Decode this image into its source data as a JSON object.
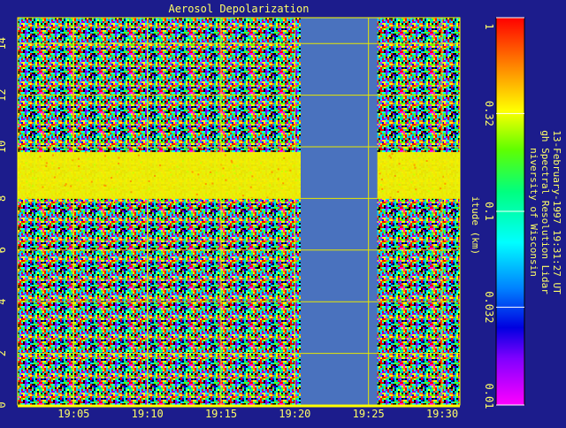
{
  "chart_data": {
    "type": "heatmap",
    "title": "Aerosol Depolarization",
    "ylabel": "itude (km)",
    "x_ticks": [
      "19:05",
      "19:10",
      "19:15",
      "19:20",
      "19:25",
      "19:30"
    ],
    "x_tick_minutes": [
      5,
      10,
      15,
      20,
      25,
      30
    ],
    "xlim_minutes": [
      1.2,
      31.2
    ],
    "y_ticks": [
      "0",
      "2",
      "4",
      "6",
      "8",
      "10",
      "12",
      "14"
    ],
    "y_tick_values": [
      0,
      2,
      4,
      6,
      8,
      10,
      12,
      14
    ],
    "ylim": [
      0,
      15
    ],
    "grid": true,
    "colorbar": {
      "scale": "log",
      "range": [
        0.01,
        1
      ],
      "tick_labels": [
        "1",
        "0.32",
        "0.1",
        "0.032",
        "0.01"
      ],
      "tick_values": [
        1,
        0.32,
        0.1,
        0.032,
        0.01
      ]
    },
    "no_data_minutes": [
      [
        20.4,
        25.6
      ]
    ],
    "cloud_layer_km": [
      8.0,
      9.8
    ],
    "no_data_color": "#4a72be",
    "grid_color": "#e8e800",
    "cloud_color": "#f2f000"
  },
  "side_text": {
    "line1": "niversity of Wisconsin",
    "line2": "gh Spectral Resolution Lidar",
    "line3": "13-February-1997 19:31:27 UT"
  }
}
